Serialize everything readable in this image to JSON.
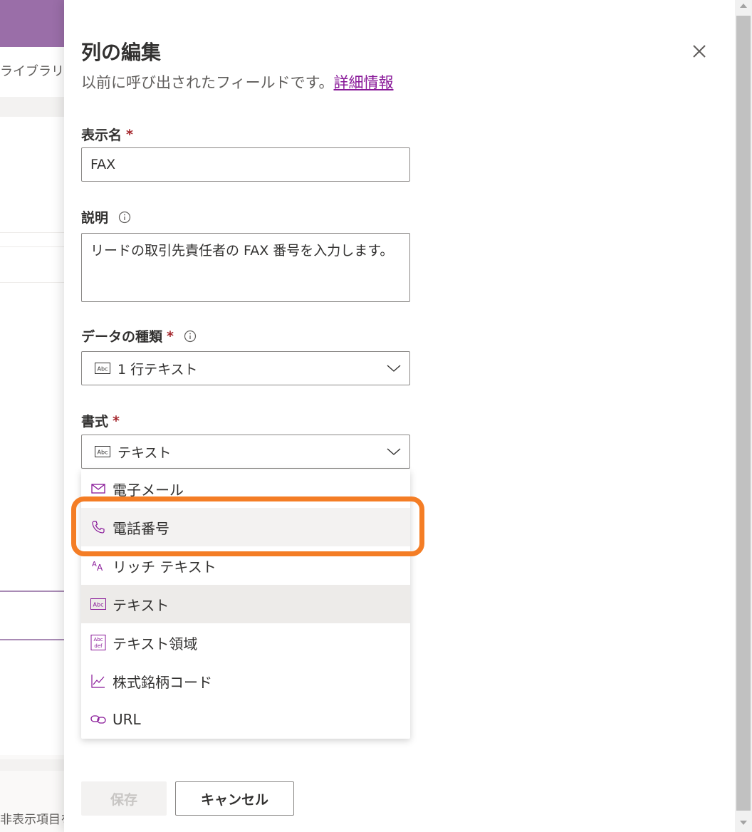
{
  "background": {
    "nav_text": "ライブラリ",
    "footer_text": "非表示項目を"
  },
  "panel": {
    "title": "列の編集",
    "subtitle": "以前に呼び出されたフィールドです。",
    "learn_more": "詳細情報",
    "close_icon": "close-icon"
  },
  "fields": {
    "display_name": {
      "label": "表示名",
      "required": "*",
      "value": "FAX"
    },
    "description": {
      "label": "説明",
      "value": "リードの取引先責任者の FAX 番号を入力します。"
    },
    "data_type": {
      "label": "データの種類",
      "required": "*",
      "value": "1 行テキスト"
    },
    "format": {
      "label": "書式",
      "required": "*",
      "value": "テキスト"
    }
  },
  "format_menu": {
    "items": [
      {
        "label": "電子メール",
        "icon": "mail-icon"
      },
      {
        "label": "電話番号",
        "icon": "phone-icon",
        "state": "hover"
      },
      {
        "label": "リッチ テキスト",
        "icon": "rich-text-icon"
      },
      {
        "label": "テキスト",
        "icon": "text-icon",
        "state": "selected"
      },
      {
        "label": "テキスト領域",
        "icon": "text-area-icon"
      },
      {
        "label": "株式銘柄コード",
        "icon": "stock-chart-icon"
      },
      {
        "label": "URL",
        "icon": "link-icon"
      }
    ]
  },
  "buttons": {
    "save": "保存",
    "cancel": "キャンセル"
  },
  "colors": {
    "accent": "#881798",
    "required": "#a4262c",
    "highlight": "#f47d25",
    "header": "#9a6ea8"
  }
}
